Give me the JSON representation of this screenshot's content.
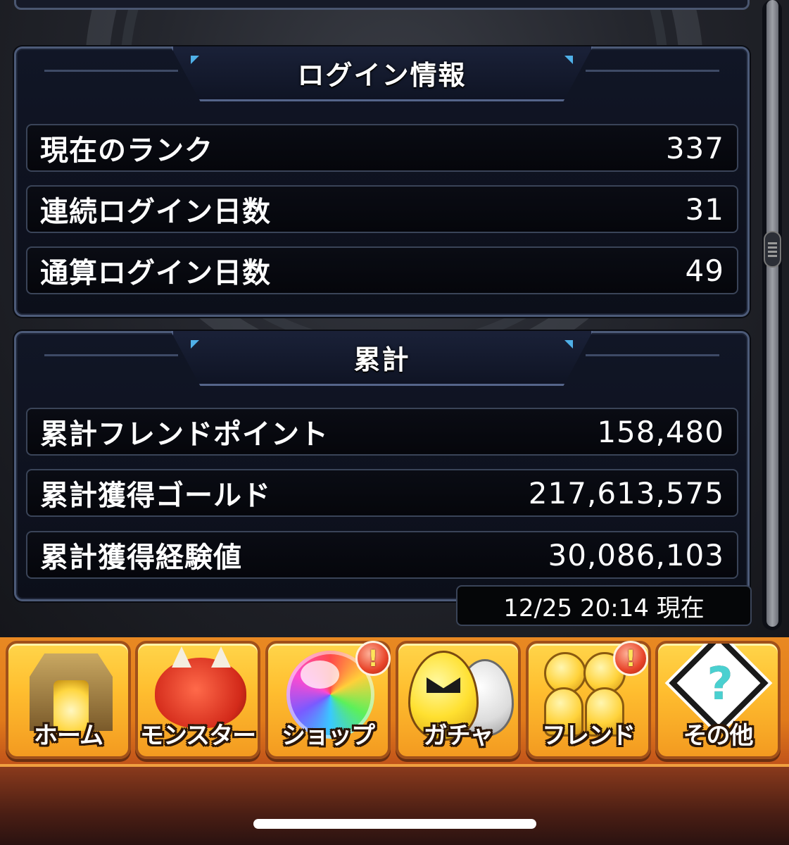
{
  "login_info": {
    "title": "ログイン情報",
    "rows": [
      {
        "label": "現在のランク",
        "value": "337"
      },
      {
        "label": "連続ログイン日数",
        "value": "31"
      },
      {
        "label": "通算ログイン日数",
        "value": "49"
      }
    ]
  },
  "cumulative": {
    "title": "累計",
    "rows": [
      {
        "label": "累計フレンドポイント",
        "value": "158,480"
      },
      {
        "label": "累計獲得ゴールド",
        "value": "217,613,575"
      },
      {
        "label": "累計獲得経験値",
        "value": "30,086,103"
      }
    ]
  },
  "timestamp": "12/25 20:14 現在",
  "nav": {
    "items": [
      {
        "label": "ホーム",
        "icon": "home-gate-icon",
        "alert": false
      },
      {
        "label": "モンスター",
        "icon": "monster-icon",
        "alert": false
      },
      {
        "label": "ショップ",
        "icon": "rainbow-orb-icon",
        "alert": true
      },
      {
        "label": "ガチャ",
        "icon": "egg-icon",
        "alert": false
      },
      {
        "label": "フレンド",
        "icon": "friends-icon",
        "alert": true
      },
      {
        "label": "その他",
        "icon": "question-sign-icon",
        "alert": false
      }
    ],
    "alert_symbol": "!"
  },
  "colors": {
    "panel_border": "#4c5a78",
    "nav_orange": "#ffbf30",
    "alert_red": "#e8452a"
  }
}
